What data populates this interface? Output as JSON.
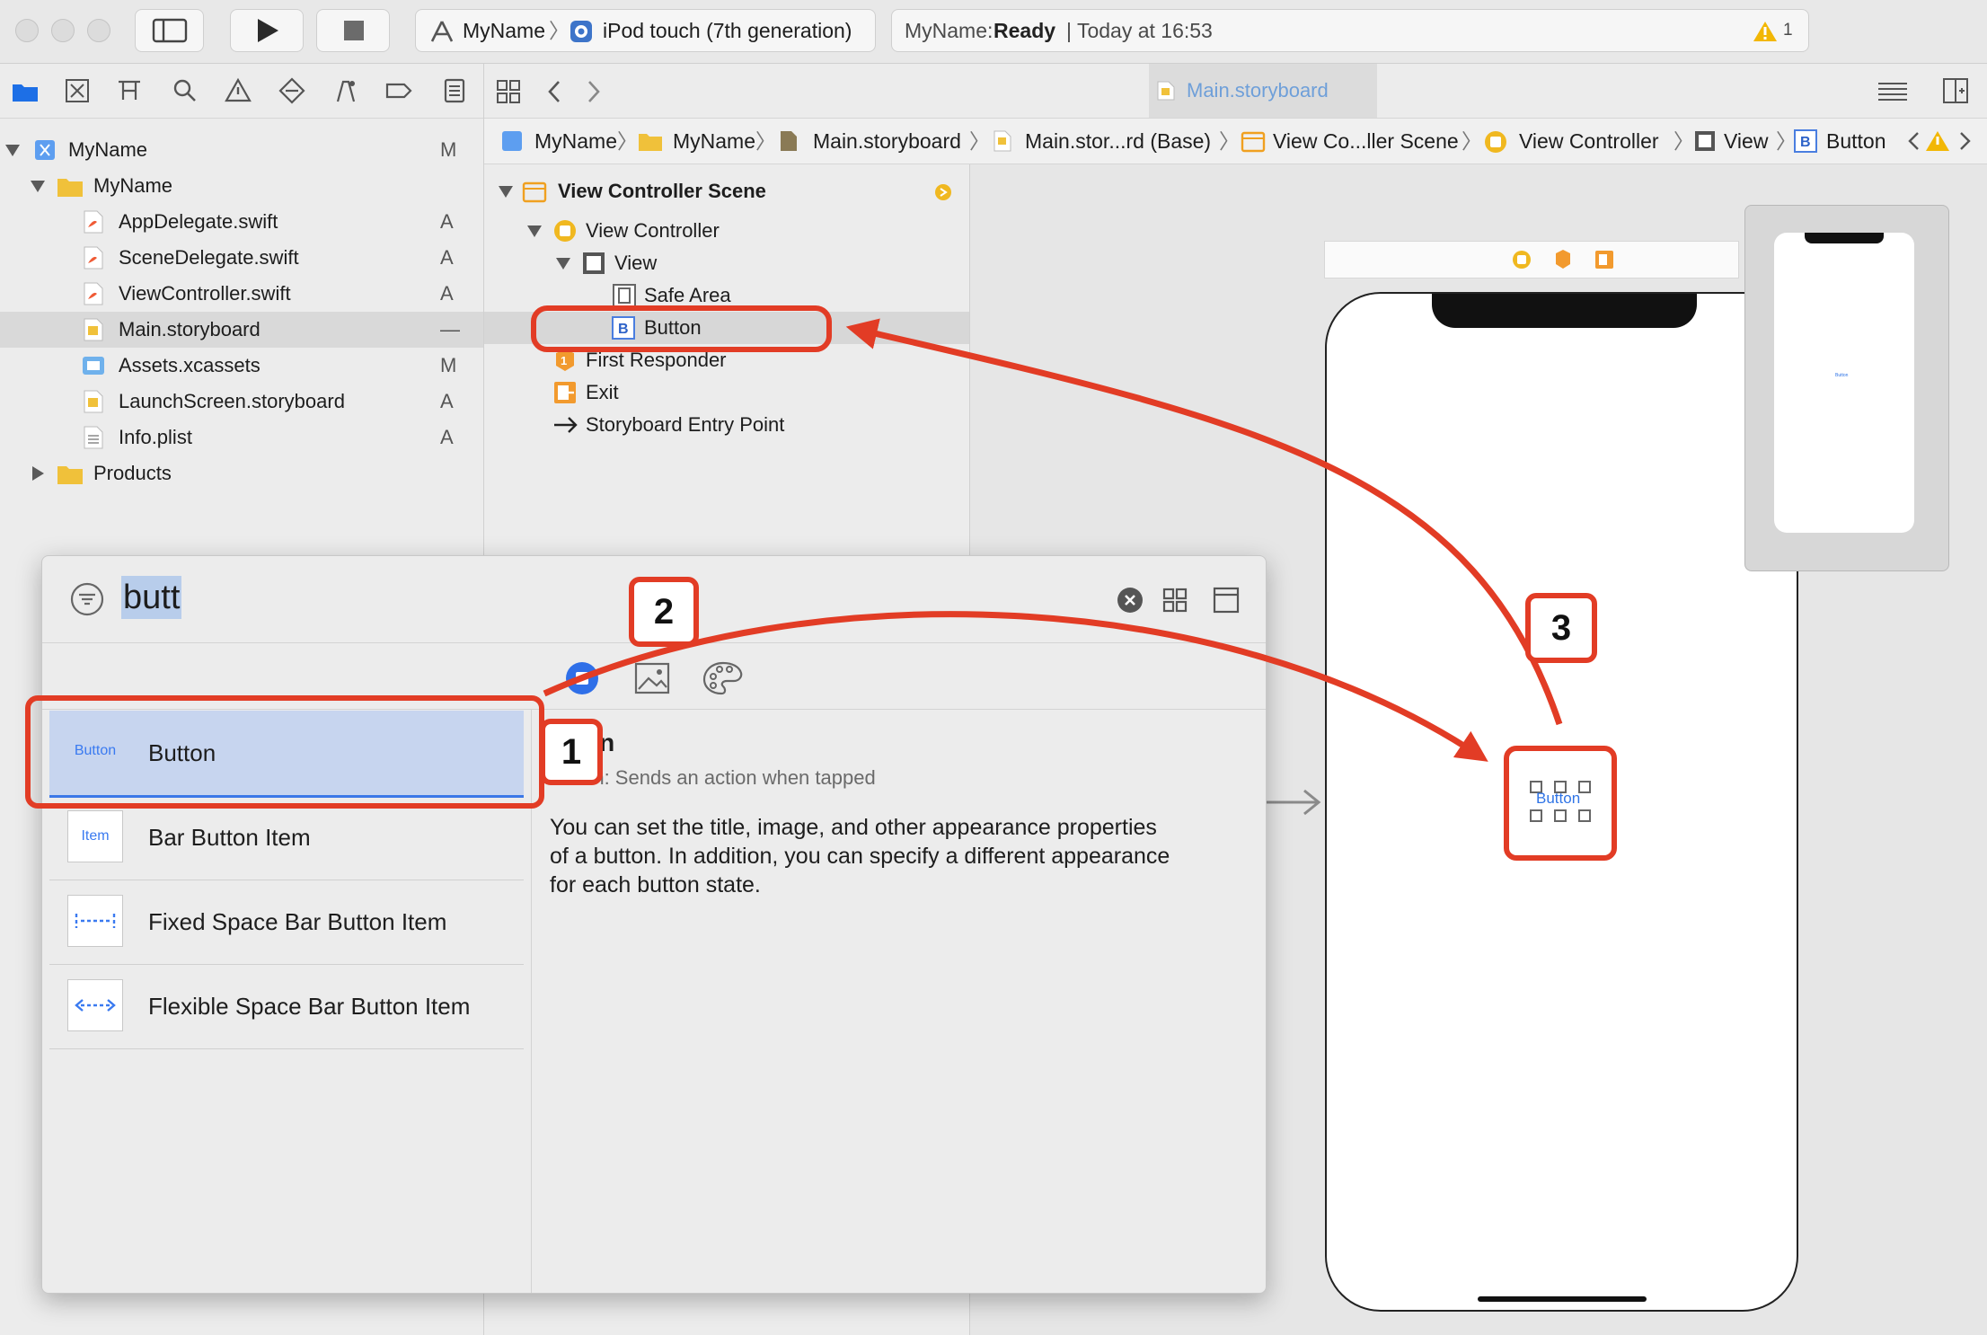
{
  "toolbar": {
    "scheme_target": "MyName",
    "scheme_device": "iPod touch (7th generation)",
    "activity_app": "MyName:",
    "activity_status": "Ready",
    "activity_time": "| Today at 16:53",
    "warning_count": "1"
  },
  "navigator": {
    "items": [
      {
        "label": "MyName",
        "status": "M"
      },
      {
        "label": "MyName",
        "status": ""
      },
      {
        "label": "AppDelegate.swift",
        "status": "A"
      },
      {
        "label": "SceneDelegate.swift",
        "status": "A"
      },
      {
        "label": "ViewController.swift",
        "status": "A"
      },
      {
        "label": "Main.storyboard",
        "status": "—"
      },
      {
        "label": "Assets.xcassets",
        "status": "M"
      },
      {
        "label": "LaunchScreen.storyboard",
        "status": "A"
      },
      {
        "label": "Info.plist",
        "status": "A"
      },
      {
        "label": "Products",
        "status": ""
      }
    ]
  },
  "editor": {
    "tab_label": "Main.storyboard",
    "breadcrumbs": [
      "MyName",
      "MyName",
      "Main.storyboard",
      "Main.stor...rd (Base)",
      "View Co...ller Scene",
      "View Controller",
      "View",
      "Button"
    ]
  },
  "outline": {
    "scene": "View Controller Scene",
    "items": [
      "View Controller",
      "View",
      "Safe Area",
      "Button",
      "First Responder",
      "Exit",
      "Storyboard Entry Point"
    ]
  },
  "library": {
    "search_text": "butt",
    "items": [
      {
        "thumb": "Button",
        "label": "Button"
      },
      {
        "thumb": "Item",
        "label": "Bar Button Item"
      },
      {
        "thumb": "",
        "label": "Fixed Space Bar Button Item"
      },
      {
        "thumb": "",
        "label": "Flexible Space Bar Button Item"
      }
    ],
    "detail_title": "on",
    "detail_subtitle": "ton: Sends an action when tapped",
    "detail_desc_lines": [
      "You can set the title, image, and other appearance properties",
      "of a button. In addition, you can specify a different appearance",
      "for each button state."
    ]
  },
  "canvas": {
    "button_text": "Button",
    "mini_button_text": "Button"
  },
  "annotations": {
    "step1": "1",
    "step2": "2",
    "step3": "3"
  },
  "colors": {
    "accent_red": "#e23c25",
    "selection_blue": "#c7d5ef",
    "link_blue": "#3a7af0"
  }
}
